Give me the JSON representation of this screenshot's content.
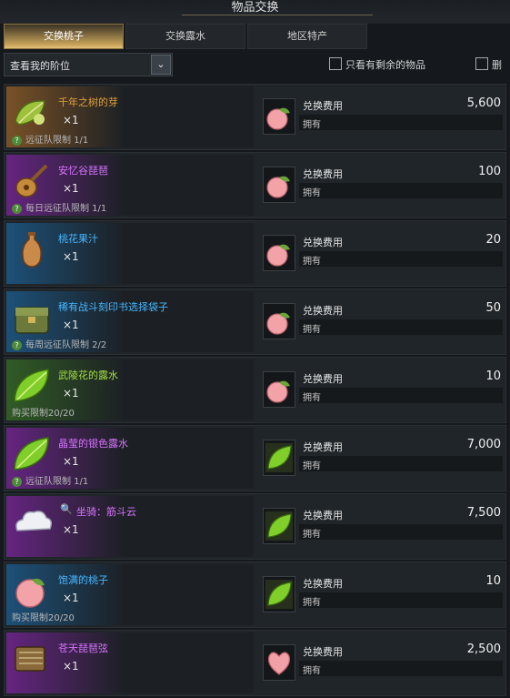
{
  "header": {
    "title": "物品交换"
  },
  "tabs": [
    {
      "label": "交换桃子"
    },
    {
      "label": "交换露水"
    },
    {
      "label": "地区特产"
    }
  ],
  "filter": {
    "label": "查看我的阶位"
  },
  "options": {
    "remaining_only": "只看有剩余的物品",
    "delete_label": "删"
  },
  "colors": {
    "orange": "#e2a13a",
    "purple": "#d873ff",
    "blue": "#46b6ff",
    "green": "#a3df3f"
  },
  "common": {
    "cost_label": "兑换费用",
    "own_label": "拥有"
  },
  "items": [
    {
      "name": "千年之树的芽",
      "qty": "×1",
      "limit": "远征队限制 1/1",
      "cost": "5,600",
      "cost_icon": "peach-icon",
      "icon": "leaf-bud-icon",
      "grade": "orange"
    },
    {
      "name": "安忆谷琵琶",
      "qty": "×1",
      "limit": "每日远征队限制 1/1",
      "cost": "100",
      "cost_icon": "peach-icon",
      "icon": "lute-icon",
      "grade": "purple"
    },
    {
      "name": "桃花果汁",
      "qty": "×1",
      "limit": "",
      "cost": "20",
      "cost_icon": "peach-icon",
      "icon": "vase-icon",
      "grade": "blue"
    },
    {
      "name": "稀有战斗刻印书选择袋子",
      "qty": "×1",
      "limit": "每周远征队限制 2/2",
      "cost": "50",
      "cost_icon": "peach-icon",
      "icon": "bag-icon",
      "grade": "blue"
    },
    {
      "name": "武陵花的露水",
      "qty": "×1",
      "limit": "购买限制20/20",
      "cost": "10",
      "cost_icon": "peach-icon",
      "icon": "green-leaf-icon",
      "grade": "green"
    },
    {
      "name": "晶莹的银色露水",
      "qty": "×1",
      "limit": "远征队限制 1/1",
      "cost": "7,000",
      "cost_icon": "dew-leaf-icon",
      "icon": "green-leaf-icon",
      "grade": "purple"
    },
    {
      "name": "坐骑：筋斗云",
      "qty": "×1",
      "limit": "",
      "cost": "7,500",
      "cost_icon": "dew-leaf-icon",
      "icon": "cloud-icon",
      "grade": "purple"
    },
    {
      "name": "饱满的桃子",
      "qty": "×1",
      "limit": "购买限制20/20",
      "cost": "10",
      "cost_icon": "dew-leaf-icon",
      "icon": "peach-icon",
      "grade": "blue"
    },
    {
      "name": "苍天琵琶弦",
      "qty": "×1",
      "limit": "",
      "cost": "2,500",
      "cost_icon": "heart-peach-icon",
      "icon": "strings-icon",
      "grade": "purple"
    }
  ]
}
